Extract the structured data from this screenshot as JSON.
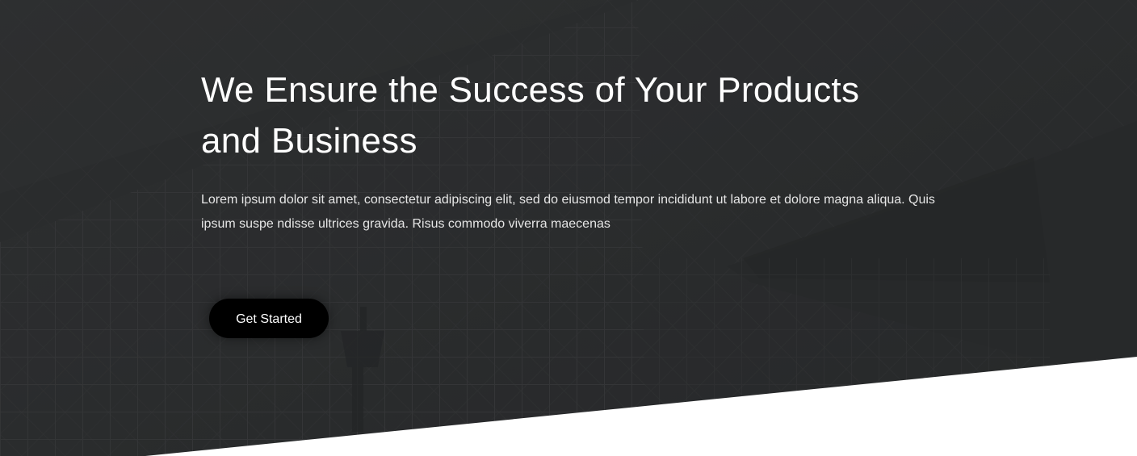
{
  "hero": {
    "headline": "We Ensure the Success of Your Products and Business",
    "paragraph": "Lorem ipsum dolor sit amet, consectetur adipiscing elit, sed do eiusmod tempor incididunt ut labore et dolore magna aliqua. Quis ipsum suspe ndisse ultrices gravida. Risus commodo viverra maecenas",
    "cta_label": "Get Started",
    "background_image": "building-facade-photo",
    "colors": {
      "overlay": "#2c2d2f",
      "text": "#ffffff",
      "button": "#000000",
      "page": "#ffffff"
    }
  }
}
